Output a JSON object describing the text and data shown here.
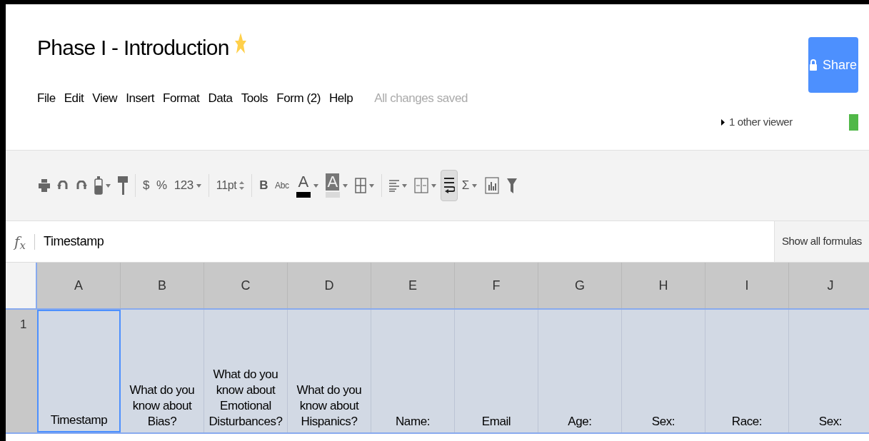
{
  "title": "Phase I - Introduction",
  "starred": true,
  "menu": [
    "File",
    "Edit",
    "View",
    "Insert",
    "Format",
    "Data",
    "Tools",
    "Form (2)",
    "Help"
  ],
  "save_status": "All changes saved",
  "share_button": "Share",
  "viewers": "1 other viewer",
  "toolbar": [
    {
      "kind": "print"
    },
    {
      "kind": "undo"
    },
    {
      "kind": "redo"
    },
    {
      "kind": "paint"
    },
    {
      "kind": "roller"
    },
    {
      "kind": "separator"
    },
    {
      "kind": "text",
      "label": "$"
    },
    {
      "kind": "text",
      "label": "%"
    },
    {
      "kind": "text-menu",
      "label": "123"
    },
    {
      "kind": "separator"
    },
    {
      "kind": "spinner",
      "label": "11pt"
    },
    {
      "kind": "separator"
    },
    {
      "kind": "bold",
      "label": "B",
      "selected": false
    },
    {
      "kind": "strike",
      "label": "Abc",
      "selected": false
    },
    {
      "kind": "text-color",
      "label": "A",
      "color": "#000000"
    },
    {
      "kind": "fill-color",
      "label": "A",
      "color": "#dadada"
    },
    {
      "kind": "borders"
    },
    {
      "kind": "separator"
    },
    {
      "kind": "align"
    },
    {
      "kind": "merge"
    },
    {
      "kind": "wrap",
      "selected": true
    },
    {
      "kind": "text-menu",
      "label": "Σ"
    },
    {
      "kind": "chart"
    },
    {
      "kind": "filter"
    }
  ],
  "formula_bar": {
    "label": "f$_{x}$",
    "value": "Timestamp",
    "button": "Show all formulas"
  },
  "columns": [
    "A",
    "B",
    "C",
    "D",
    "E",
    "F",
    "G",
    "H",
    "I",
    "J"
  ],
  "rows": [
    {
      "number": "1",
      "cells": [
        {
          "text": "Timestamp",
          "selected": true
        },
        {
          "text": "What do you know about Bias?",
          "selected": false
        },
        {
          "text": "What do you know about Emotional Disturbances?",
          "selected": false
        },
        {
          "text": "What do you know about Hispanics?",
          "selected": false
        },
        {
          "text": "Name:",
          "selected": false
        },
        {
          "text": "Email",
          "selected": false
        },
        {
          "text": "Age:",
          "selected": false
        },
        {
          "text": "Sex:",
          "selected": false
        },
        {
          "text": "Race:",
          "selected": false
        },
        {
          "text": "Sex:",
          "selected": false
        }
      ]
    }
  ]
}
